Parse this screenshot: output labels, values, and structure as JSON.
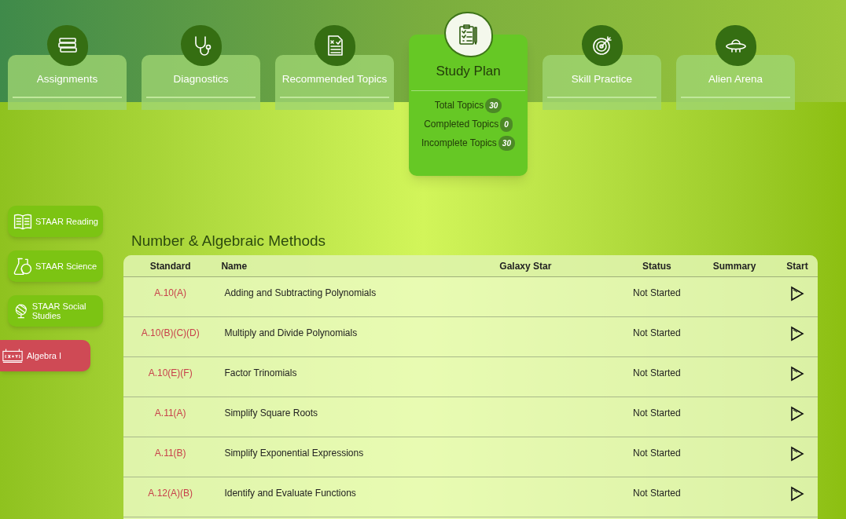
{
  "nav_tabs": [
    {
      "label": "Assignments",
      "kind": "books",
      "selected": false
    },
    {
      "label": "Diagnostics",
      "kind": "stethoscope",
      "selected": false
    },
    {
      "label": "Recommended Topics",
      "kind": "checklist",
      "selected": false
    },
    {
      "label": "Study Plan",
      "kind": "clipboard",
      "selected": true,
      "stats": [
        {
          "label": "Total Topics",
          "count": "30"
        },
        {
          "label": "Completed Topics",
          "count": "0"
        },
        {
          "label": "Incomplete Topics",
          "count": "30"
        }
      ]
    },
    {
      "label": "Skill Practice",
      "kind": "target",
      "selected": false
    },
    {
      "label": "Alien Arena",
      "kind": "ufo",
      "selected": false
    }
  ],
  "subjects": [
    {
      "label": "STAAR Reading",
      "kind": "book",
      "selected": false
    },
    {
      "label": "STAAR Science",
      "kind": "flask",
      "selected": false
    },
    {
      "label": "STAAR Social Studies",
      "kind": "globe",
      "selected": false
    },
    {
      "label": "Algebra I",
      "kind": "formula",
      "selected": true
    }
  ],
  "section_title": "Number & Algebraic Methods",
  "table": {
    "columns": [
      "Standard",
      "Name",
      "Galaxy Star",
      "Status",
      "Summary",
      "Start"
    ],
    "rows": [
      {
        "standard": "A.10(A)",
        "name": "Adding and Subtracting Polynomials",
        "status": "Not Started"
      },
      {
        "standard": "A.10(B)(C)(D)",
        "name": "Multiply and Divide Polynomials",
        "status": "Not Started"
      },
      {
        "standard": "A.10(E)(F)",
        "name": "Factor Trinomials",
        "status": "Not Started"
      },
      {
        "standard": "A.11(A)",
        "name": "Simplify Square Roots",
        "status": "Not Started"
      },
      {
        "standard": "A.11(B)",
        "name": "Simplify Exponential Expressions",
        "status": "Not Started"
      },
      {
        "standard": "A.12(A)(B)",
        "name": "Identify and Evaluate Functions",
        "status": "Not Started"
      }
    ]
  }
}
